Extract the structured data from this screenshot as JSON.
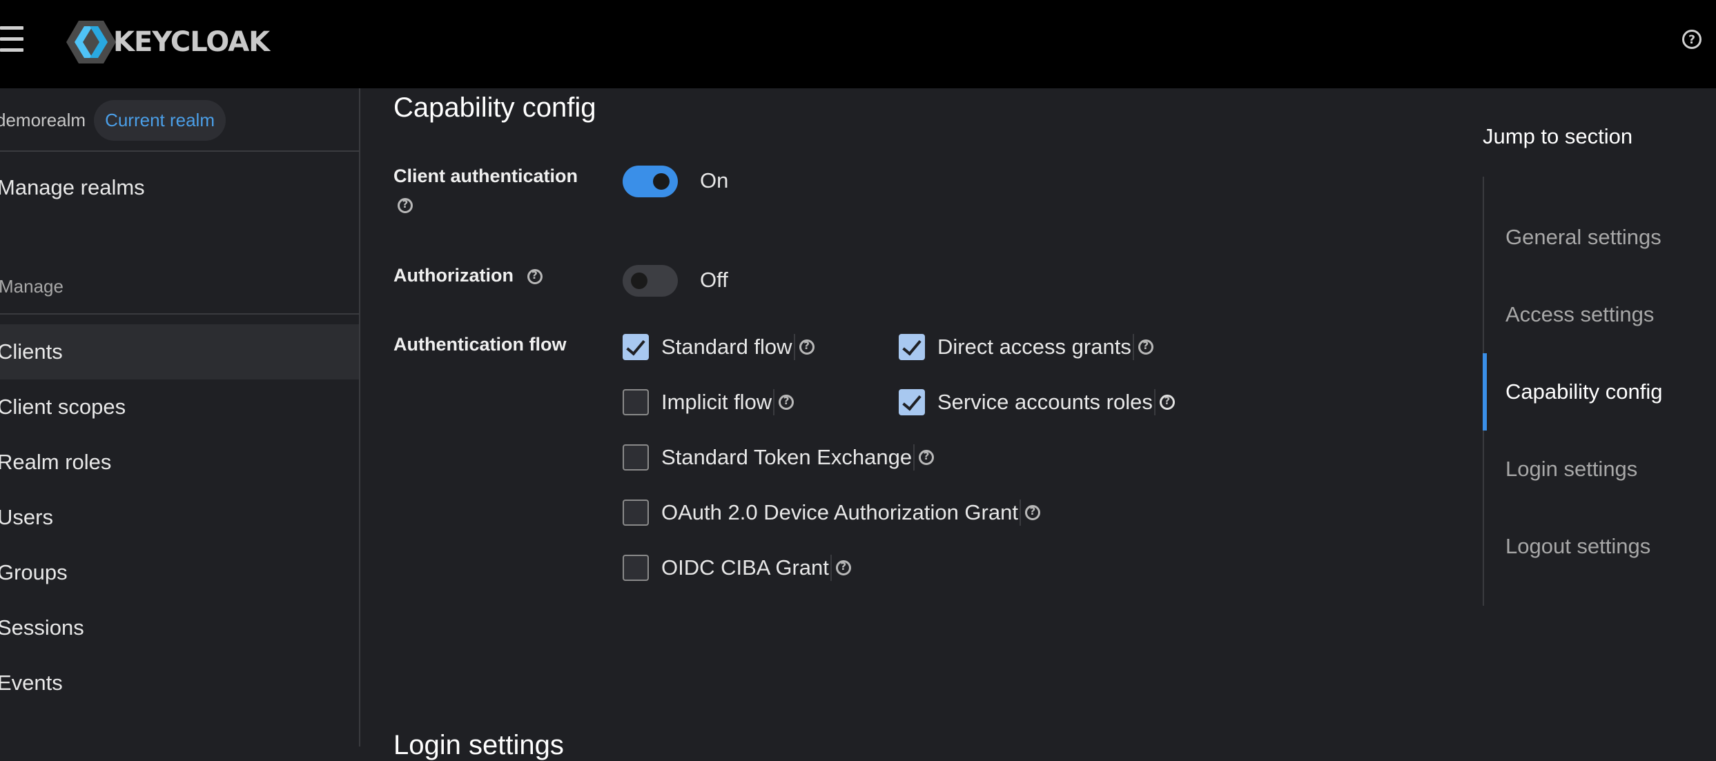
{
  "header": {
    "logo_text": "KEYCLOAK"
  },
  "sidebar": {
    "realm_name": "demorealm",
    "realm_badge": "Current realm",
    "manage_realms": "Manage realms",
    "section_label": "Manage",
    "items": [
      {
        "label": "Clients",
        "active": true
      },
      {
        "label": "Client scopes"
      },
      {
        "label": "Realm roles"
      },
      {
        "label": "Users"
      },
      {
        "label": "Groups"
      },
      {
        "label": "Sessions"
      },
      {
        "label": "Events"
      }
    ]
  },
  "main": {
    "title": "Capability config",
    "client_auth": {
      "label": "Client authentication",
      "state": "On",
      "enabled": true
    },
    "authorization": {
      "label": "Authorization",
      "state": "Off",
      "enabled": false
    },
    "auth_flow": {
      "label": "Authentication flow",
      "options": [
        {
          "label": "Standard flow",
          "checked": true
        },
        {
          "label": "Direct access grants",
          "checked": true
        },
        {
          "label": "Implicit flow",
          "checked": false
        },
        {
          "label": "Service accounts roles",
          "checked": true
        },
        {
          "label": "Standard Token Exchange",
          "checked": false
        },
        {
          "label": "OAuth 2.0 Device Authorization Grant",
          "checked": false
        },
        {
          "label": "OIDC CIBA Grant",
          "checked": false
        }
      ]
    },
    "next_section_title": "Login settings"
  },
  "jump": {
    "title": "Jump to section",
    "items": [
      {
        "label": "General settings"
      },
      {
        "label": "Access settings"
      },
      {
        "label": "Capability config",
        "active": true
      },
      {
        "label": "Login settings"
      },
      {
        "label": "Logout settings"
      }
    ]
  },
  "colors": {
    "accent": "#3a8fe8",
    "header_bg": "#000000",
    "page_bg": "#1f2024",
    "badge_text": "#4b9fe8"
  }
}
